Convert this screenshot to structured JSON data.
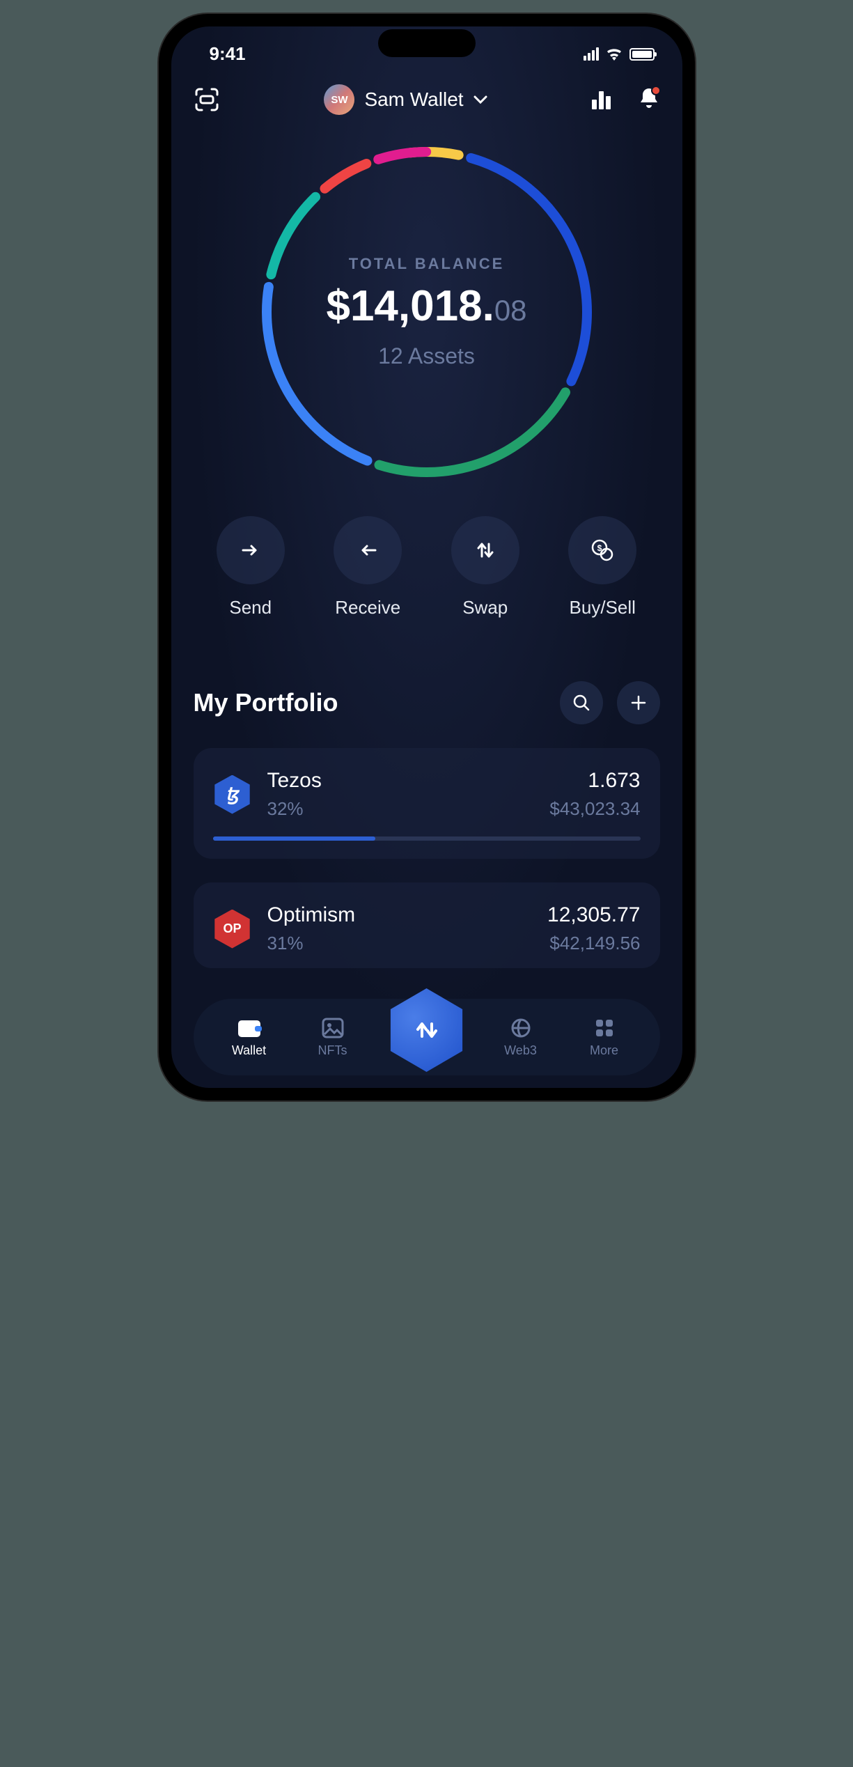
{
  "status": {
    "time": "9:41"
  },
  "header": {
    "avatar_initials": "SW",
    "wallet_name": "Sam Wallet"
  },
  "balance": {
    "label": "TOTAL BALANCE",
    "whole": "$14,018.",
    "cents": "08",
    "assets_text": "12 Assets"
  },
  "actions": {
    "send": "Send",
    "receive": "Receive",
    "swap": "Swap",
    "buysell": "Buy/Sell"
  },
  "portfolio": {
    "title": "My Portfolio",
    "items": [
      {
        "name": "Tezos",
        "pct": "32%",
        "amount": "1.673",
        "usd": "$43,023.34",
        "symbol": "ꜩ",
        "color": "hex-blue",
        "progress": 38
      },
      {
        "name": "Optimism",
        "pct": "31%",
        "amount": "12,305.77",
        "usd": "$42,149.56",
        "symbol": "OP",
        "color": "hex-red",
        "progress": 0
      }
    ]
  },
  "nav": {
    "wallet": "Wallet",
    "nfts": "NFTs",
    "web3": "Web3",
    "more": "More"
  },
  "chart_data": {
    "type": "pie",
    "title": "TOTAL BALANCE",
    "series": [
      {
        "name": "segment-1",
        "value": 6,
        "color": "#f7c948"
      },
      {
        "name": "segment-2",
        "value": 28,
        "color": "#1d4ed8"
      },
      {
        "name": "segment-3",
        "value": 22,
        "color": "#22a06b"
      },
      {
        "name": "segment-4",
        "value": 22,
        "color": "#3b82f6"
      },
      {
        "name": "segment-5",
        "value": 10,
        "color": "#14b8a6"
      },
      {
        "name": "segment-6",
        "value": 6,
        "color": "#ef4444"
      },
      {
        "name": "segment-7",
        "value": 6,
        "color": "#e11d8f"
      }
    ]
  }
}
